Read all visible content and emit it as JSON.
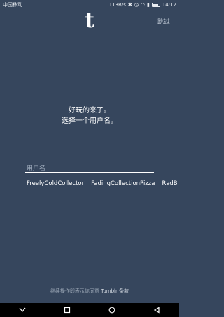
{
  "status_bar": {
    "carrier": "中国移动",
    "net_speed": "113B/s",
    "time": "14:12"
  },
  "header": {
    "logo": "t",
    "next_label": "跳过"
  },
  "prompt": {
    "line1": "好玩的来了。",
    "line2": "选择一个用户名。"
  },
  "username": {
    "placeholder": "用户名",
    "value": ""
  },
  "suggestions": [
    "FreelyColdCollector",
    "FadingCollectionPizza",
    "RadB"
  ],
  "footer": {
    "text": "继续操作即表示你同意 ",
    "link": "Tumblr 条款"
  },
  "nav": {
    "icons": [
      "back-icon",
      "home-icon",
      "recents-icon",
      "notification-icon"
    ]
  }
}
